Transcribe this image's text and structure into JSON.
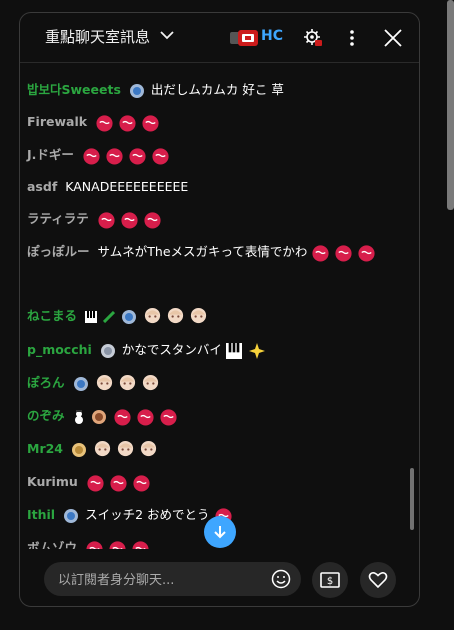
{
  "header": {
    "title": "重點聊天室訊息",
    "hc_label": "HC"
  },
  "messages": [
    {
      "author": "밥보다Sweeets",
      "text": "出だしムカムカ 好こ 草",
      "emotes": 0,
      "green": true
    },
    {
      "author": "Firewalk",
      "text": "",
      "emotes": 3,
      "green": false
    },
    {
      "author": "J.ドギー",
      "text": "",
      "emotes": 4,
      "green": false
    },
    {
      "author": "asdf",
      "text": "KANADEEEEEEEEEE",
      "emotes": 0,
      "green": false
    },
    {
      "author": "ラティラテ",
      "text": "",
      "emotes": 3,
      "green": false
    },
    {
      "author": "ぽっぽルー",
      "text": "サムネがTheメスガキって表情でかわ",
      "emotes": 3,
      "green": false
    },
    {
      "author": "ねこまる",
      "text": "",
      "emotes": 3,
      "green": true
    },
    {
      "author": "p_mocchi",
      "text": "かなでスタンバイ",
      "emotes": 0,
      "green": true
    },
    {
      "author": "ぽろん",
      "text": "",
      "emotes": 3,
      "green": true
    },
    {
      "author": "のぞみ",
      "text": "",
      "emotes": 3,
      "green": true
    },
    {
      "author": "Mr24",
      "text": "",
      "emotes": 3,
      "green": true
    },
    {
      "author": "Kurimu",
      "text": "",
      "emotes": 3,
      "green": false
    },
    {
      "author": "Ithil",
      "text": "スイッチ2 おめでとう",
      "emotes": 1,
      "green": true
    },
    {
      "author": "ボムゾウ",
      "text": "",
      "emotes": 3,
      "green": false
    }
  ],
  "input": {
    "placeholder": "以訂閱者身分聊天..."
  },
  "icons": [
    "chevron-down-icon",
    "gear-icon",
    "more-vert-icon",
    "close-icon",
    "emoji-icon",
    "super-chat-icon",
    "heart-icon",
    "arrow-down-icon"
  ],
  "colors": {
    "accent": "#3ea6ff",
    "member": "#2ba640",
    "emote_red": "#d71e4b"
  }
}
